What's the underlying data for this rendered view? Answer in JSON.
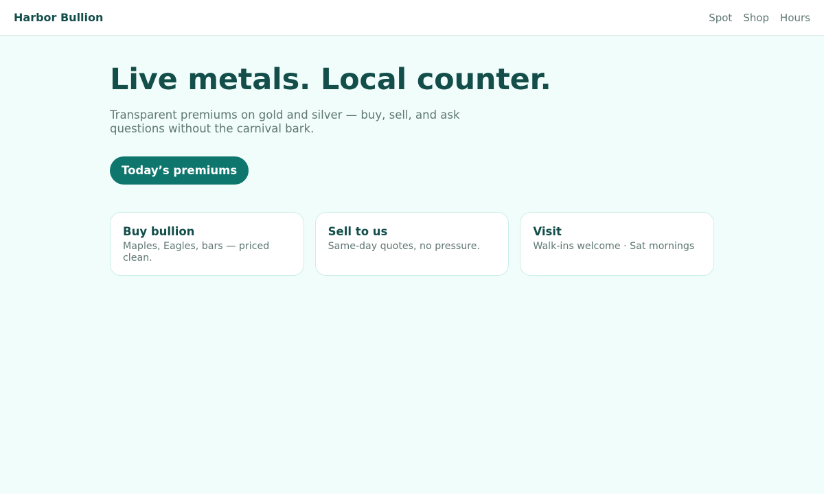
{
  "header": {
    "brand": "Harbor Bullion",
    "nav": [
      {
        "label": "Spot"
      },
      {
        "label": "Shop"
      },
      {
        "label": "Hours"
      }
    ]
  },
  "hero": {
    "headline": "Live metals. Local counter.",
    "subhead": "Transparent premiums on gold and silver — buy, sell, and ask questions without the carnival bark.",
    "cta_label": "Today’s premiums"
  },
  "cards": [
    {
      "title": "Buy bullion",
      "desc": "Maples, Eagles, bars — priced clean."
    },
    {
      "title": "Sell to us",
      "desc": "Same-day quotes, no pressure."
    },
    {
      "title": "Visit",
      "desc": "Walk-ins welcome · Sat mornings"
    }
  ],
  "colors": {
    "background": "#f0fdfa",
    "accent": "#0f766e",
    "heading": "#134e4a",
    "muted": "#5f7773"
  }
}
